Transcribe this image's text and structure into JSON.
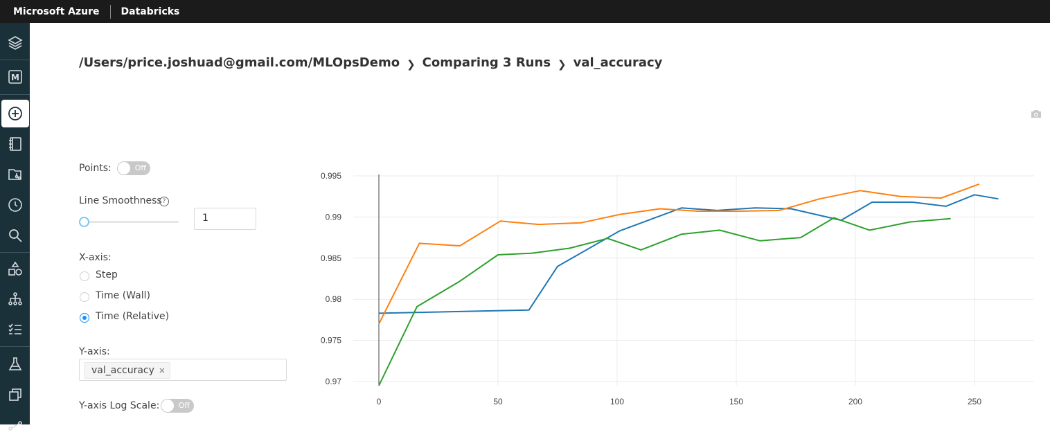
{
  "topbar": {
    "brand": "Microsoft Azure",
    "product": "Databricks"
  },
  "sidebar": {
    "items": [
      {
        "icon": "layers-icon"
      },
      {
        "icon": "mlflow-m-icon"
      },
      {
        "icon": "create-plus-icon",
        "active": true
      },
      {
        "icon": "notebook-icon"
      },
      {
        "icon": "repos-icon"
      },
      {
        "icon": "recents-clock-icon"
      },
      {
        "icon": "search-icon"
      },
      {
        "icon": "shapes-icon"
      },
      {
        "icon": "models-tree-icon"
      },
      {
        "icon": "checklist-icon"
      },
      {
        "icon": "experiments-flask-icon"
      },
      {
        "icon": "copy-icon"
      },
      {
        "icon": "workflow-icon"
      }
    ]
  },
  "breadcrumb": {
    "path": "/Users/price.joshuad@gmail.com/MLOpsDemo",
    "compare": "Comparing 3 Runs",
    "metric": "val_accuracy"
  },
  "controls": {
    "points_label": "Points:",
    "points_toggle": "Off",
    "smoothness_label": "Line Smoothness",
    "smoothness_help": "?",
    "smoothness_value": "1",
    "smoothness_slider_fraction": 0,
    "xaxis_label": "X-axis:",
    "xaxis_options": [
      {
        "label": "Step",
        "checked": false
      },
      {
        "label": "Time (Wall)",
        "checked": false
      },
      {
        "label": "Time (Relative)",
        "checked": true
      }
    ],
    "yaxis_label": "Y-axis:",
    "yaxis_tag": "val_accuracy",
    "yaxis_tag_remove": "×",
    "log_label": "Y-axis Log Scale:",
    "log_toggle": "Off"
  },
  "chart_data": {
    "type": "line",
    "xlim": [
      0,
      275
    ],
    "ylim": [
      0.9695,
      0.9955
    ],
    "x_ticks": [
      0,
      50,
      100,
      150,
      200,
      250
    ],
    "y_ticks": [
      0.97,
      0.975,
      0.98,
      0.985,
      0.99,
      0.995
    ],
    "y_tick_labels": [
      "0.97",
      "0.975",
      "0.98",
      "0.985",
      "0.99",
      "0.995"
    ],
    "grid": true,
    "series": [
      {
        "color": "#1f77b4",
        "x": [
          0,
          63,
          75,
          101,
          127,
          142,
          158,
          173,
          194,
          207,
          224,
          238,
          250,
          260
        ],
        "y": [
          0.9783,
          0.9787,
          0.984,
          0.9883,
          0.9911,
          0.9908,
          0.9911,
          0.991,
          0.9896,
          0.9918,
          0.9918,
          0.9913,
          0.9927,
          0.9922
        ]
      },
      {
        "color": "#ff7f0e",
        "x": [
          0,
          17,
          34,
          51,
          67,
          85,
          101,
          118,
          134,
          151,
          168,
          185,
          202,
          219,
          236,
          252
        ],
        "y": [
          0.977,
          0.9868,
          0.9865,
          0.9895,
          0.9891,
          0.9893,
          0.9903,
          0.991,
          0.9907,
          0.9907,
          0.9908,
          0.9922,
          0.9932,
          0.9925,
          0.9923,
          0.994
        ]
      },
      {
        "color": "#2ca02c",
        "x": [
          0,
          16,
          34,
          50,
          64,
          80,
          96,
          110,
          127,
          143,
          160,
          177,
          191,
          206,
          223,
          240
        ],
        "y": [
          0.9695,
          0.9791,
          0.9822,
          0.9854,
          0.9856,
          0.9862,
          0.9874,
          0.986,
          0.9879,
          0.9884,
          0.9871,
          0.9875,
          0.9899,
          0.9884,
          0.9894,
          0.9898
        ]
      }
    ]
  }
}
